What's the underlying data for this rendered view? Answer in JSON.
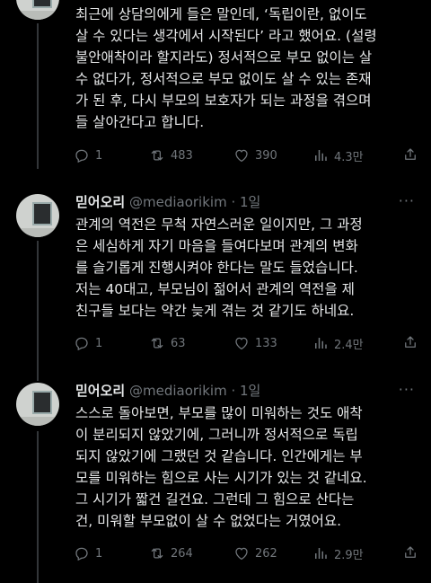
{
  "tweet0": {
    "lines": [
      "최근에 상담의에게 들은 말인데, ‘독립이란, 없이도",
      "살 수 있다는 생각에서 시작된다’ 라고 했어요. (설령",
      "불안애착이라 할지라도) 정서적으로 부모 없이는 살",
      "수 없다가, 정서적으로 부모 없이도 살 수 있는 존재",
      "가 된 후, 다시 부모의 보호자가 되는 과정을 겪으며",
      "들 살아간다고 합니다."
    ],
    "replies": "1",
    "retweets": "483",
    "likes": "390",
    "views": "4.3만"
  },
  "tweet1": {
    "name": "믿어오리",
    "handle": "@mediaorikim",
    "time": "· 1일",
    "more": "···",
    "lines": [
      "관계의 역전은 무척 자연스러운 일이지만, 그 과정",
      "은 세심하게 자기 마음을 들여다보며 관계의 변화",
      "를 슬기롭게 진행시켜야 한다는 말도 들었습니다.",
      "저는 40대고, 부모님이 젊어서 관계의 역전을 제",
      "친구들 보다는 약간 늦게 겪는 것 같기도 하네요."
    ],
    "replies": "1",
    "retweets": "63",
    "likes": "133",
    "views": "2.4만"
  },
  "tweet2": {
    "name": "믿어오리",
    "handle": "@mediaorikim",
    "time": "· 1일",
    "more": "···",
    "lines": [
      "스스로 돌아보면, 부모를 많이 미워하는 것도 애착",
      "이 분리되지 않았기에, 그러니까 정서적으로 독립",
      "되지 않았기에 그랬던 것 같습니다. 인간에게는 부",
      "모를 미워하는 힘으로 사는 시기가 있는 것 같네요.",
      "그 시기가 짧건 길건요. 그런데 그 힘으로 산다는",
      "건, 미워할 부모없이 살 수 없었다는 거였어요."
    ],
    "replies": "1",
    "retweets": "264",
    "likes": "262",
    "views": "2.9만"
  }
}
